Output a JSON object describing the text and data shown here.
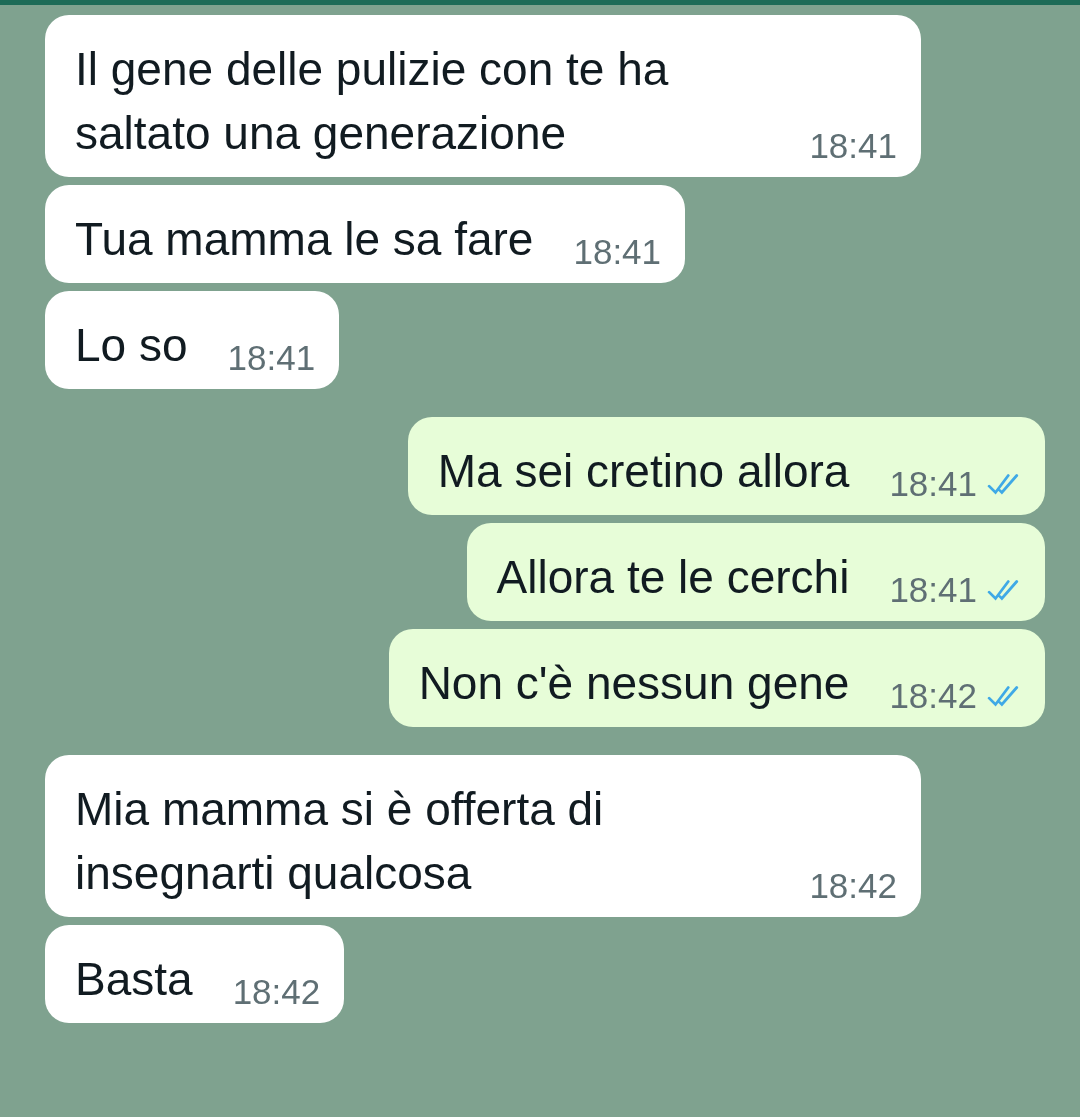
{
  "messages": [
    {
      "kind": "in",
      "text": "Il gene delle pulizie con te ha saltato una generazione",
      "time": "18:41"
    },
    {
      "kind": "in",
      "text": "Tua mamma le sa fare",
      "time": "18:41"
    },
    {
      "kind": "in",
      "text": "Lo so",
      "time": "18:41"
    },
    {
      "kind": "out",
      "text": "Ma sei cretino allora",
      "time": "18:41",
      "read": true
    },
    {
      "kind": "out",
      "text": "Allora te le cerchi",
      "time": "18:41",
      "read": true
    },
    {
      "kind": "out",
      "text": "Non c'è nessun gene",
      "time": "18:42",
      "read": true
    },
    {
      "kind": "in",
      "text": "Mia mamma si è offerta di insegnarti qualcosa",
      "time": "18:42"
    },
    {
      "kind": "in",
      "text": "Basta",
      "time": "18:42"
    }
  ]
}
